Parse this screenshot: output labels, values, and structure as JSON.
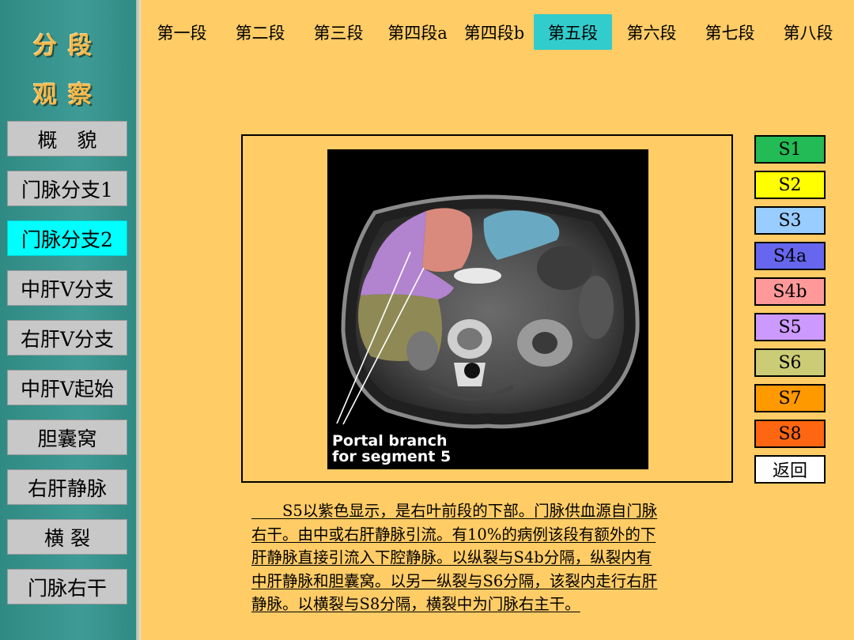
{
  "sidebar": {
    "title_line1": "分段",
    "title_line2": "观察",
    "items": [
      {
        "label": "概　貌"
      },
      {
        "label": "门脉分支1"
      },
      {
        "label": "门脉分支2"
      },
      {
        "label": "中肝V分支"
      },
      {
        "label": "右肝V分支"
      },
      {
        "label": "中肝V起始"
      },
      {
        "label": "胆囊窝"
      },
      {
        "label": "右肝静脉"
      },
      {
        "label": "横 裂"
      },
      {
        "label": "门脉右干"
      }
    ],
    "active_index": 2
  },
  "tabs": {
    "items": [
      {
        "label": "第一段"
      },
      {
        "label": "第二段"
      },
      {
        "label": "第三段"
      },
      {
        "label": "第四段a"
      },
      {
        "label": "第四段b"
      },
      {
        "label": "第五段"
      },
      {
        "label": "第六段"
      },
      {
        "label": "第七段"
      },
      {
        "label": "第八段"
      }
    ],
    "active_index": 5
  },
  "image": {
    "annotation_line1": "Portal branch",
    "annotation_line2": "for segment 5"
  },
  "segments": {
    "items": [
      {
        "label": "S1",
        "color": "#22bb55"
      },
      {
        "label": "S2",
        "color": "#ffff00"
      },
      {
        "label": "S3",
        "color": "#99ccff"
      },
      {
        "label": "S4a",
        "color": "#6666ee"
      },
      {
        "label": "S4b",
        "color": "#ff9999"
      },
      {
        "label": "S5",
        "color": "#cc99ff"
      },
      {
        "label": "S6",
        "color": "#cccc77"
      },
      {
        "label": "S7",
        "color": "#ff9900"
      },
      {
        "label": "S8",
        "color": "#ff6611"
      },
      {
        "label": "返回",
        "color": "#ffffff"
      }
    ]
  },
  "description": {
    "lines": [
      "　　S5以紫色显示，是右叶前段的下部。门脉供血源自门脉",
      "右干。由中或右肝静脉引流。有10%的病例该段有额外的下",
      "肝静脉直接引流入下腔静脉。以纵裂与S4b分隔，纵裂内有",
      "中肝静脉和胆囊窝。以另一纵裂与S6分隔，该裂内走行右肝",
      "静脉。以横裂与S8分隔，横裂中为门脉右主干。"
    ]
  }
}
